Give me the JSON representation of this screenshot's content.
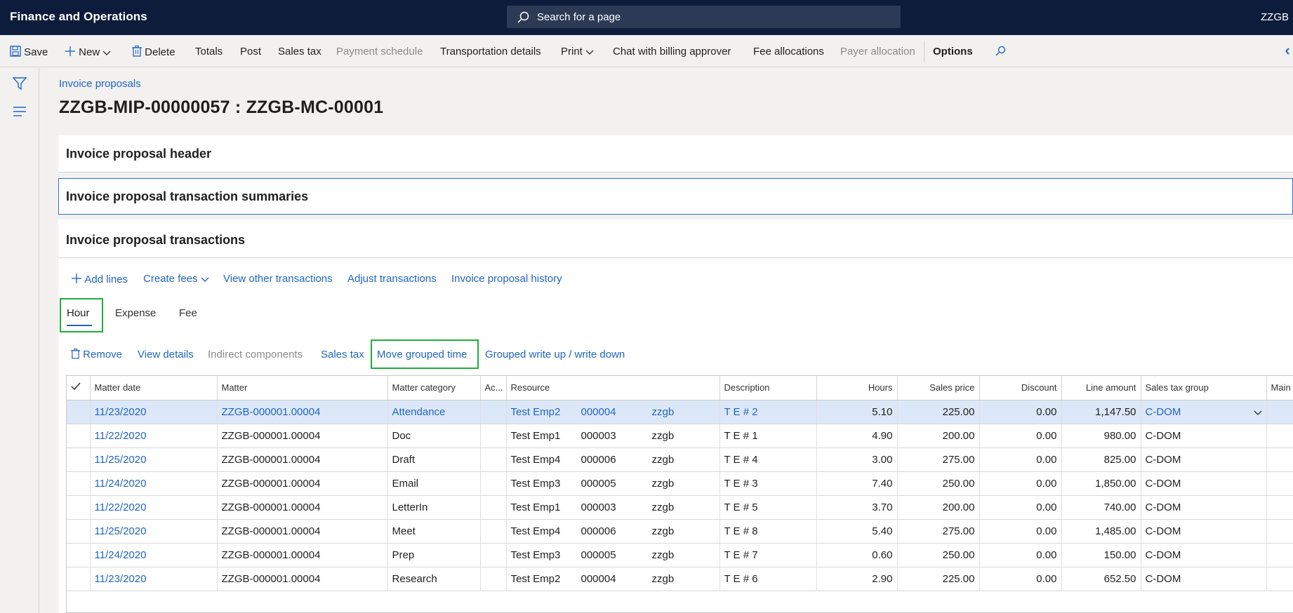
{
  "topbar": {
    "app_title": "Finance and Operations",
    "search_placeholder": "Search for a page",
    "company": "ZZGB"
  },
  "actions": {
    "save": "Save",
    "new": "New",
    "delete": "Delete",
    "totals": "Totals",
    "post": "Post",
    "sales_tax": "Sales tax",
    "payment_schedule": "Payment schedule",
    "transportation_details": "Transportation details",
    "print": "Print",
    "chat": "Chat with billing approver",
    "fee_allocations": "Fee allocations",
    "payer_allocation": "Payer allocation",
    "options": "Options"
  },
  "breadcrumb": "Invoice proposals",
  "page_title": "ZZGB-MIP-00000057 : ZZGB-MC-00001",
  "sections": {
    "header": "Invoice proposal header",
    "summaries": "Invoice proposal transaction summaries",
    "transactions": "Invoice proposal transactions"
  },
  "trans_toolbar": {
    "add_lines": "Add lines",
    "create_fees": "Create fees",
    "view_other": "View other transactions",
    "adjust": "Adjust transactions",
    "history": "Invoice proposal history"
  },
  "tabs": {
    "hour": "Hour",
    "expense": "Expense",
    "fee": "Fee"
  },
  "grid_toolbar": {
    "remove": "Remove",
    "view_details": "View details",
    "indirect": "Indirect components",
    "sales_tax": "Sales tax",
    "move_grouped": "Move grouped time",
    "grouped_write": "Grouped write up / write down"
  },
  "columns": [
    "Matter date",
    "Matter",
    "Matter category",
    "Ac...",
    "Resource",
    "Description",
    "Hours",
    "Sales price",
    "Discount",
    "Line amount",
    "Sales tax group",
    "Main"
  ],
  "rows": [
    {
      "date": "11/23/2020",
      "matter": "ZZGB-000001.00004",
      "category": "Attendance",
      "res_name": "Test Emp2",
      "res_id": "000004",
      "res_co": "zzgb",
      "desc": "T E # 2",
      "hours": "5.10",
      "price": "225.00",
      "discount": "0.00",
      "amount": "1,147.50",
      "tax": "C-DOM"
    },
    {
      "date": "11/22/2020",
      "matter": "ZZGB-000001.00004",
      "category": "Doc",
      "res_name": "Test Emp1",
      "res_id": "000003",
      "res_co": "zzgb",
      "desc": "T E # 1",
      "hours": "4.90",
      "price": "200.00",
      "discount": "0.00",
      "amount": "980.00",
      "tax": "C-DOM"
    },
    {
      "date": "11/25/2020",
      "matter": "ZZGB-000001.00004",
      "category": "Draft",
      "res_name": "Test Emp4",
      "res_id": "000006",
      "res_co": "zzgb",
      "desc": "T E # 4",
      "hours": "3.00",
      "price": "275.00",
      "discount": "0.00",
      "amount": "825.00",
      "tax": "C-DOM"
    },
    {
      "date": "11/24/2020",
      "matter": "ZZGB-000001.00004",
      "category": "Email",
      "res_name": "Test Emp3",
      "res_id": "000005",
      "res_co": "zzgb",
      "desc": "T E # 3",
      "hours": "7.40",
      "price": "250.00",
      "discount": "0.00",
      "amount": "1,850.00",
      "tax": "C-DOM"
    },
    {
      "date": "11/22/2020",
      "matter": "ZZGB-000001.00004",
      "category": "LetterIn",
      "res_name": "Test Emp1",
      "res_id": "000003",
      "res_co": "zzgb",
      "desc": "T E # 5",
      "hours": "3.70",
      "price": "200.00",
      "discount": "0.00",
      "amount": "740.00",
      "tax": "C-DOM"
    },
    {
      "date": "11/25/2020",
      "matter": "ZZGB-000001.00004",
      "category": "Meet",
      "res_name": "Test Emp4",
      "res_id": "000006",
      "res_co": "zzgb",
      "desc": "T E # 8",
      "hours": "5.40",
      "price": "275.00",
      "discount": "0.00",
      "amount": "1,485.00",
      "tax": "C-DOM"
    },
    {
      "date": "11/24/2020",
      "matter": "ZZGB-000001.00004",
      "category": "Prep",
      "res_name": "Test Emp3",
      "res_id": "000005",
      "res_co": "zzgb",
      "desc": "T E # 7",
      "hours": "0.60",
      "price": "250.00",
      "discount": "0.00",
      "amount": "150.00",
      "tax": "C-DOM"
    },
    {
      "date": "11/23/2020",
      "matter": "ZZGB-000001.00004",
      "category": "Research",
      "res_name": "Test Emp2",
      "res_id": "000004",
      "res_co": "zzgb",
      "desc": "T E # 6",
      "hours": "2.90",
      "price": "225.00",
      "discount": "0.00",
      "amount": "652.50",
      "tax": "C-DOM"
    }
  ],
  "colors": {
    "topbar": "#0c1c3a",
    "link": "#2266c0",
    "highlight": "#1fae3a",
    "selected_row": "#dce8f8"
  }
}
